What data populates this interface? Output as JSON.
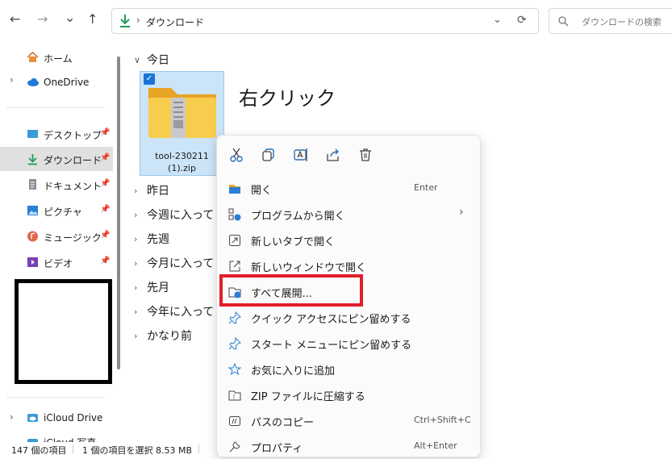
{
  "toolbar": {
    "back": "←",
    "forward": "→",
    "recent": "⌄",
    "up": "↑",
    "address": "ダウンロード",
    "search_placeholder": "ダウンロードの検索"
  },
  "sidebar": {
    "items": [
      {
        "label": "ホーム",
        "icon": "home-icon"
      },
      {
        "label": "OneDrive",
        "icon": "cloud-icon"
      },
      {
        "label": "デスクトップ",
        "icon": "desktop-icon"
      },
      {
        "label": "ダウンロード",
        "icon": "download-icon"
      },
      {
        "label": "ドキュメント",
        "icon": "document-icon"
      },
      {
        "label": "ピクチャ",
        "icon": "picture-icon"
      },
      {
        "label": "ミュージック",
        "icon": "music-icon"
      },
      {
        "label": "ビデオ",
        "icon": "video-icon"
      },
      {
        "label": "iCloud Drive",
        "icon": "icloud-icon"
      },
      {
        "label": "iCloud 写真",
        "icon": "icloud-photos-icon"
      }
    ]
  },
  "main": {
    "groups": [
      "今日",
      "昨日",
      "今週に入って (",
      "先週",
      "今月に入って (",
      "先月",
      "今年に入って (",
      "かなり前"
    ],
    "file": {
      "name_line1": "tool-230211",
      "name_line2": "(1).zip"
    },
    "annotation": "右クリック"
  },
  "context_menu": {
    "items": [
      {
        "label": "開く",
        "shortcut": "Enter"
      },
      {
        "label": "プログラムから開く",
        "shortcut": "›"
      },
      {
        "label": "新しいタブで開く",
        "shortcut": ""
      },
      {
        "label": "新しいウィンドウで開く",
        "shortcut": ""
      },
      {
        "label": "すべて展開...",
        "shortcut": ""
      },
      {
        "label": "クイック アクセスにピン留めする",
        "shortcut": ""
      },
      {
        "label": "スタート メニューにピン留めする",
        "shortcut": ""
      },
      {
        "label": "お気に入りに追加",
        "shortcut": ""
      },
      {
        "label": "ZIP ファイルに圧縮する",
        "shortcut": ""
      },
      {
        "label": "パスのコピー",
        "shortcut": "Ctrl+Shift+C"
      },
      {
        "label": "プロパティ",
        "shortcut": "Alt+Enter"
      }
    ],
    "highlight_color": "#e01f2a"
  },
  "status": {
    "count": "147 個の項目",
    "selection": "1 個の項目を選択  8.53 MB"
  }
}
